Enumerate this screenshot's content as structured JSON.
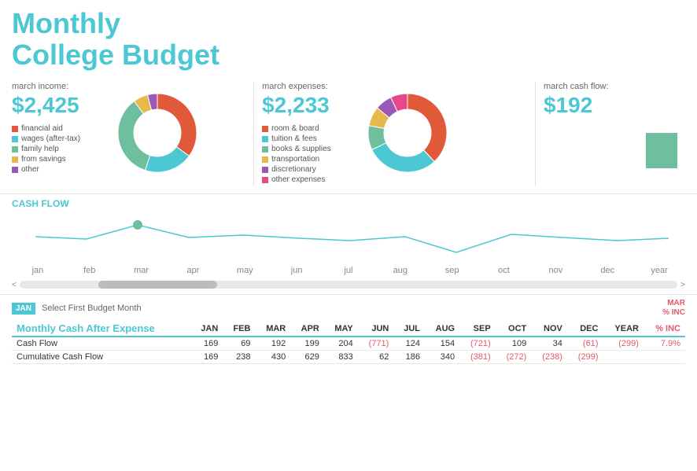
{
  "header": {
    "title_line1": "Monthly",
    "title_line2": "College Budget"
  },
  "income": {
    "label": "march income:",
    "amount": "$2,425",
    "legend": [
      {
        "label": "financial aid",
        "color": "#e05a3a"
      },
      {
        "label": "wages (after-tax)",
        "color": "#4bc8d4"
      },
      {
        "label": "family help",
        "color": "#6dbf9e"
      },
      {
        "label": "from savings",
        "color": "#e8b84b"
      },
      {
        "label": "other",
        "color": "#9b59b6"
      }
    ],
    "donut": {
      "segments": [
        {
          "value": 35,
          "color": "#e05a3a"
        },
        {
          "value": 20,
          "color": "#4bc8d4"
        },
        {
          "value": 35,
          "color": "#6dbf9e"
        },
        {
          "value": 6,
          "color": "#e8b84b"
        },
        {
          "value": 4,
          "color": "#9b59b6"
        }
      ]
    }
  },
  "expenses": {
    "label": "march expenses:",
    "amount": "$2,233",
    "legend": [
      {
        "label": "room & board",
        "color": "#e05a3a"
      },
      {
        "label": "tuition & fees",
        "color": "#4bc8d4"
      },
      {
        "label": "books & supplies",
        "color": "#6dbf9e"
      },
      {
        "label": "transportation",
        "color": "#e8b84b"
      },
      {
        "label": "discretionary",
        "color": "#9b59b6"
      },
      {
        "label": "other expenses",
        "color": "#e8478a"
      }
    ],
    "donut": {
      "segments": [
        {
          "value": 38,
          "color": "#e05a3a"
        },
        {
          "value": 30,
          "color": "#4bc8d4"
        },
        {
          "value": 10,
          "color": "#6dbf9e"
        },
        {
          "value": 8,
          "color": "#e8b84b"
        },
        {
          "value": 7,
          "color": "#9b59b6"
        },
        {
          "value": 7,
          "color": "#e8478a"
        }
      ]
    }
  },
  "cashflow_summary": {
    "label": "march cash flow:",
    "amount": "$192"
  },
  "chart": {
    "label": "CASH FLOW",
    "months": [
      "jan",
      "feb",
      "mar",
      "apr",
      "may",
      "jun",
      "jul",
      "aug",
      "sep",
      "oct",
      "nov",
      "dec",
      "year"
    ],
    "scroll_left": "<",
    "scroll_right": ">"
  },
  "table": {
    "jan_badge": "JAN",
    "select_text": "Select First Budget Month",
    "mar_inc_header": "MAR\n% INC",
    "title": "Monthly Cash After Expense",
    "columns": [
      "JAN",
      "FEB",
      "MAR",
      "APR",
      "MAY",
      "JUN",
      "JUL",
      "AUG",
      "SEP",
      "OCT",
      "NOV",
      "DEC",
      "YEAR"
    ],
    "rows": [
      {
        "label": "Cash Flow",
        "values": [
          "169",
          "69",
          "192",
          "199",
          "204",
          "(771)",
          "124",
          "154",
          "(721)",
          "109",
          "34",
          "(61)",
          "(299)"
        ],
        "negative": [
          false,
          false,
          false,
          false,
          false,
          true,
          false,
          false,
          true,
          false,
          false,
          true,
          true
        ],
        "mar_inc": "7.9%"
      },
      {
        "label": "Cumulative Cash Flow",
        "values": [
          "169",
          "238",
          "430",
          "629",
          "833",
          "62",
          "186",
          "340",
          "(381)",
          "(272)",
          "(238)",
          "(299)",
          ""
        ],
        "negative": [
          false,
          false,
          false,
          false,
          false,
          false,
          false,
          false,
          true,
          true,
          true,
          true,
          false
        ],
        "mar_inc": ""
      }
    ]
  }
}
